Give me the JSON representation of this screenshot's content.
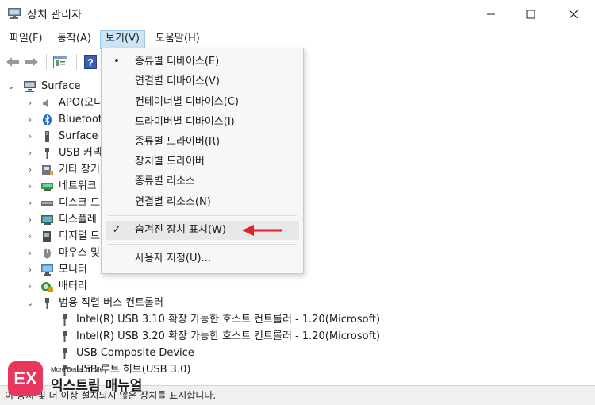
{
  "window": {
    "title": "장치 관리자"
  },
  "menubar": [
    {
      "label": "파일(F)"
    },
    {
      "label": "동작(A)"
    },
    {
      "label": "보기(V)"
    },
    {
      "label": "도움말(H)"
    }
  ],
  "tree": {
    "root": "Surface",
    "items": [
      {
        "label": "APO(오디"
      },
      {
        "label": "Bluetoot"
      },
      {
        "label": "Surface S"
      },
      {
        "label": "USB 커넥"
      },
      {
        "label": "기타 장기"
      },
      {
        "label": "네트워크"
      },
      {
        "label": "디스크 드"
      },
      {
        "label": "디스플레"
      },
      {
        "label": "디지털 드"
      },
      {
        "label": "마우스 및"
      },
      {
        "label": "모니터"
      },
      {
        "label": "배터리"
      },
      {
        "label": "범용 직렬 버스 컨트롤러"
      }
    ],
    "usb_children": [
      {
        "label": "Intel(R) USB 3.10 확장 가능한 호스트 컨트롤러 - 1.20(Microsoft)"
      },
      {
        "label": "Intel(R) USB 3.20 확장 가능한 호스트 컨트롤러 - 1.20(Microsoft)"
      },
      {
        "label": "USB Composite Device"
      },
      {
        "label": "USB 루트 허브(USB 3.0)"
      }
    ]
  },
  "view_menu": {
    "items": [
      {
        "label": "종류별 디바이스(E)",
        "mark": "•"
      },
      {
        "label": "연결별 디바이스(V)",
        "mark": ""
      },
      {
        "label": "컨테이너별 디바이스(C)",
        "mark": ""
      },
      {
        "label": "드라이버별 디바이스(I)",
        "mark": ""
      },
      {
        "label": "종류별 드라이버(R)",
        "mark": ""
      },
      {
        "label": "장치별 드라이버",
        "mark": ""
      },
      {
        "label": "종류별 리소스",
        "mark": ""
      },
      {
        "label": "연결별 리소스(N)",
        "mark": ""
      }
    ],
    "hidden_devices": {
      "label": "숨겨진 장치 표시(W)",
      "mark": "✓"
    },
    "customize": {
      "label": "사용자 지정(U)..."
    }
  },
  "status": "이 장치 및 더 이상 설치되지 않은 장치를 표시합니다.",
  "watermark": {
    "logo": "EX",
    "tagline": "More Better IT Life",
    "name": "익스트림 매뉴얼"
  },
  "colors": {
    "accent_arrow": "#e0202a",
    "menu_active": "#cce4f7"
  }
}
